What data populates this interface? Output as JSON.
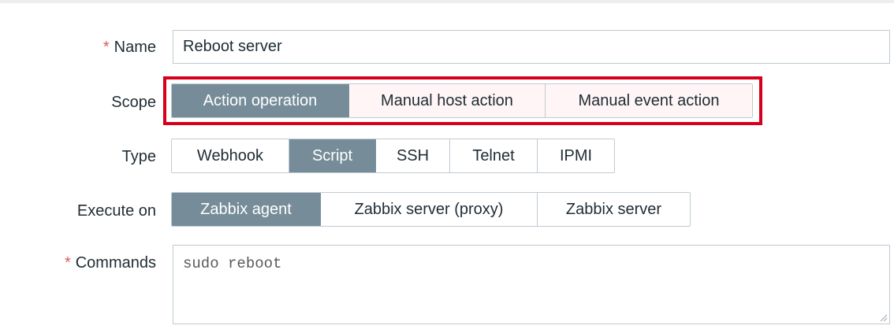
{
  "form": {
    "name": {
      "label": "Name",
      "required_mark": "*",
      "value": "Reboot server"
    },
    "scope": {
      "label": "Scope",
      "options": [
        "Action operation",
        "Manual host action",
        "Manual event action"
      ],
      "selected": "Action operation"
    },
    "type": {
      "label": "Type",
      "options": [
        "Webhook",
        "Script",
        "SSH",
        "Telnet",
        "IPMI"
      ],
      "selected": "Script"
    },
    "execute_on": {
      "label": "Execute on",
      "options": [
        "Zabbix agent",
        "Zabbix server (proxy)",
        "Zabbix server"
      ],
      "selected": "Zabbix agent"
    },
    "commands": {
      "label": "Commands",
      "required_mark": "*",
      "value": "sudo reboot"
    }
  },
  "colors": {
    "active_segment": "#768d99",
    "required_mark": "#e45959",
    "highlight_frame": "#d6001c",
    "border": "#bfcbd3",
    "scope_option_bg": "#fff5f6"
  }
}
